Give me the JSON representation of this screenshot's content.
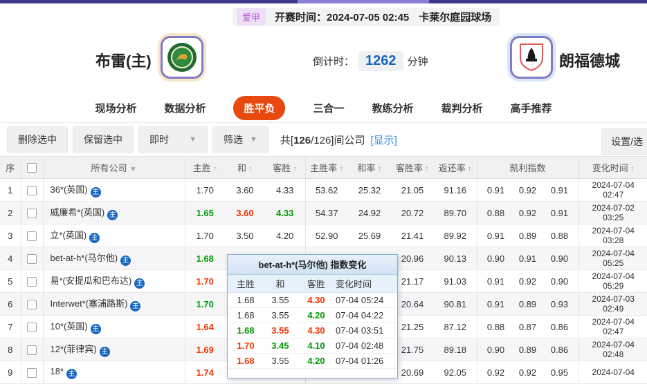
{
  "topbar": {
    "league": "爱甲",
    "kickoff": "开赛时间：2024-07-05 02:45",
    "venue": "卡莱尔庭园球场"
  },
  "match": {
    "home_name": "布雷(主)",
    "away_name": "朗福德城",
    "countdown_label": "倒计时：",
    "countdown_value": "1262",
    "countdown_unit": "分钟"
  },
  "nav": {
    "tabs": [
      {
        "label": "现场分析",
        "active": false
      },
      {
        "label": "数据分析",
        "active": false
      },
      {
        "label": "胜平负",
        "active": true
      },
      {
        "label": "三合一",
        "active": false
      },
      {
        "label": "教练分析",
        "active": false
      },
      {
        "label": "裁判分析",
        "active": false
      },
      {
        "label": "高手推荐",
        "active": false
      }
    ]
  },
  "toolbar": {
    "delete_label": "删除选中",
    "keep_label": "保留选中",
    "instant_label": "即时",
    "filter_label": "筛选",
    "caret_icon": "▼",
    "count_prefix": "共[",
    "count_selected": "126",
    "count_suffix": "/126]间公司",
    "show_label": "[显示]",
    "settings_label": "设置/选"
  },
  "icons": {
    "home_badge": "主",
    "sort_asc": "↑",
    "dropdown": "▼"
  },
  "table": {
    "columns": [
      {
        "label": "序"
      },
      {
        "checkbox": true
      },
      {
        "label": "所有公司",
        "dropdown": true
      },
      {
        "label": "主胜",
        "arrow": true
      },
      {
        "label": "和",
        "arrow": true
      },
      {
        "label": "客胜",
        "arrow": true
      },
      {
        "label": "主胜率",
        "arrow": true
      },
      {
        "label": "和率",
        "arrow": true
      },
      {
        "label": "客胜率",
        "arrow": true
      },
      {
        "label": "返还率",
        "arrow": true
      },
      {
        "label": "凯利指数"
      },
      {
        "label": "变化时间",
        "arrow": true
      }
    ],
    "rows": [
      {
        "no": "1",
        "company": "36*(英国)",
        "odds": [
          {
            "v": "1.70",
            "c": ""
          },
          {
            "v": "3.60",
            "c": ""
          },
          {
            "v": "4.33",
            "c": ""
          }
        ],
        "rates": [
          "53.62",
          "25.32",
          "21.05",
          "91.16"
        ],
        "kelly": [
          "0.91",
          "0.92",
          "0.91"
        ],
        "date": "2024-07-04",
        "time": "02:47"
      },
      {
        "no": "2",
        "company": "威廉希*(英国)",
        "odds": [
          {
            "v": "1.65",
            "c": "g"
          },
          {
            "v": "3.60",
            "c": "r"
          },
          {
            "v": "4.33",
            "c": "g"
          }
        ],
        "rates": [
          "54.37",
          "24.92",
          "20.72",
          "89.70"
        ],
        "kelly": [
          "0.88",
          "0.92",
          "0.91"
        ],
        "date": "2024-07-02",
        "time": "03:25"
      },
      {
        "no": "3",
        "company": "立*(英国)",
        "odds": [
          {
            "v": "1.70",
            "c": ""
          },
          {
            "v": "3.50",
            "c": ""
          },
          {
            "v": "4.20",
            "c": ""
          }
        ],
        "rates": [
          "52.90",
          "25.69",
          "21.41",
          "89.92"
        ],
        "kelly": [
          "0.91",
          "0.89",
          "0.88"
        ],
        "date": "2024-07-04",
        "time": "03:28"
      },
      {
        "no": "4",
        "company": "bet-at-h*(马尔他)",
        "odds": [
          {
            "v": "1.68",
            "c": "g"
          },
          {
            "v": "",
            "c": ""
          },
          {
            "v": "",
            "c": ""
          }
        ],
        "rates": [
          "",
          "",
          "20.96",
          "90.13"
        ],
        "kelly": [
          "0.90",
          "0.91",
          "0.90"
        ],
        "date": "2024-07-04",
        "time": "05:25"
      },
      {
        "no": "5",
        "company": "易*(安提瓜和巴布达)",
        "odds": [
          {
            "v": "1.70",
            "c": "r"
          },
          {
            "v": "",
            "c": ""
          },
          {
            "v": "",
            "c": ""
          }
        ],
        "rates": [
          "",
          "",
          "21.17",
          "91.03"
        ],
        "kelly": [
          "0.91",
          "0.92",
          "0.90"
        ],
        "date": "2024-07-04",
        "time": "05:29"
      },
      {
        "no": "6",
        "company": "Interwet*(塞浦路斯)",
        "odds": [
          {
            "v": "1.70",
            "c": "g"
          },
          {
            "v": "",
            "c": ""
          },
          {
            "v": "",
            "c": ""
          }
        ],
        "rates": [
          "",
          "",
          "20.64",
          "90.81"
        ],
        "kelly": [
          "0.91",
          "0.89",
          "0.93"
        ],
        "date": "2024-07-03",
        "time": "02:49"
      },
      {
        "no": "7",
        "company": "10*(英国)",
        "odds": [
          {
            "v": "1.64",
            "c": "r"
          },
          {
            "v": "",
            "c": ""
          },
          {
            "v": "",
            "c": ""
          }
        ],
        "rates": [
          "",
          "",
          "21.25",
          "87.12"
        ],
        "kelly": [
          "0.88",
          "0.87",
          "0.86"
        ],
        "date": "2024-07-04",
        "time": "02:47"
      },
      {
        "no": "8",
        "company": "12*(菲律宾)",
        "odds": [
          {
            "v": "1.69",
            "c": "r"
          },
          {
            "v": "",
            "c": ""
          },
          {
            "v": "",
            "c": ""
          }
        ],
        "rates": [
          "",
          "",
          "21.75",
          "89.18"
        ],
        "kelly": [
          "0.90",
          "0.89",
          "0.86"
        ],
        "date": "2024-07-04",
        "time": "02:48"
      },
      {
        "no": "9",
        "company": "18*",
        "odds": [
          {
            "v": "1.74",
            "c": "r"
          },
          {
            "v": "",
            "c": ""
          },
          {
            "v": "",
            "c": ""
          }
        ],
        "rates": [
          "",
          "",
          "20.69",
          "92.05"
        ],
        "kelly": [
          "0.92",
          "0.92",
          "0.95"
        ],
        "date": "2024-07-04",
        "time": ""
      }
    ]
  },
  "popup": {
    "title": "bet-at-h*(马尔他) 指数变化",
    "headers": [
      "主胜",
      "和",
      "客胜",
      "变化时间"
    ],
    "rows": [
      {
        "cells": [
          {
            "v": "1.68",
            "c": ""
          },
          {
            "v": "3.55",
            "c": ""
          },
          {
            "v": "4.30",
            "c": "r"
          }
        ],
        "time": "07-04 05:24"
      },
      {
        "cells": [
          {
            "v": "1.68",
            "c": ""
          },
          {
            "v": "3.55",
            "c": ""
          },
          {
            "v": "4.20",
            "c": "g"
          }
        ],
        "time": "07-04 04:22"
      },
      {
        "cells": [
          {
            "v": "1.68",
            "c": "g"
          },
          {
            "v": "3.55",
            "c": "r"
          },
          {
            "v": "4.30",
            "c": "r"
          }
        ],
        "time": "07-04 03:51"
      },
      {
        "cells": [
          {
            "v": "1.70",
            "c": "r"
          },
          {
            "v": "3.45",
            "c": "g"
          },
          {
            "v": "4.10",
            "c": "g"
          }
        ],
        "time": "07-04 02:48"
      },
      {
        "cells": [
          {
            "v": "1.68",
            "c": "r"
          },
          {
            "v": "3.55",
            "c": ""
          },
          {
            "v": "4.20",
            "c": "g"
          }
        ],
        "time": "07-04 01:26"
      }
    ]
  },
  "colors": {
    "accent": "#e8490f",
    "odds_up_green": "#009900",
    "odds_down_red": "#f03300",
    "link_blue": "#3a8ee6",
    "countdown_blue": "#1565c0"
  }
}
